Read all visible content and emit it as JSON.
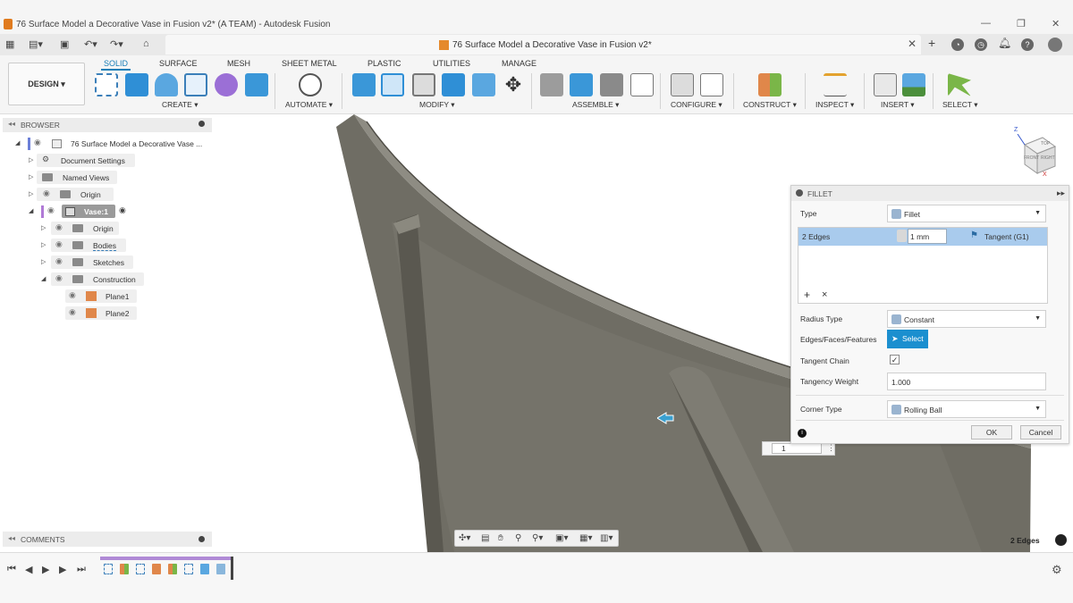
{
  "window": {
    "title": "76 Surface Model a Decorative Vase in Fusion v2* (A TEAM) - Autodesk Fusion",
    "doc_tab_title": "76 Surface Model a Decorative Vase in Fusion v2*"
  },
  "toolbar": {
    "design_label": "DESIGN ▾",
    "workspace_tabs": [
      "SOLID",
      "SURFACE",
      "MESH",
      "SHEET METAL",
      "PLASTIC",
      "UTILITIES",
      "MANAGE"
    ],
    "groups": [
      "CREATE ▾",
      "AUTOMATE ▾",
      "MODIFY ▾",
      "ASSEMBLE ▾",
      "CONFIGURE ▾",
      "CONSTRUCT ▾",
      "INSPECT ▾",
      "INSERT ▾",
      "SELECT ▾"
    ]
  },
  "browser": {
    "header": "BROWSER",
    "items": [
      {
        "label": "76 Surface Model a Decorative Vase ..."
      },
      {
        "label": "Document Settings"
      },
      {
        "label": "Named Views"
      },
      {
        "label": "Origin"
      },
      {
        "label": "Vase:1"
      },
      {
        "label": "Origin"
      },
      {
        "label": "Bodies"
      },
      {
        "label": "Sketches"
      },
      {
        "label": "Construction"
      },
      {
        "label": "Plane1"
      },
      {
        "label": "Plane2"
      }
    ]
  },
  "comments": {
    "header": "COMMENTS"
  },
  "fillet": {
    "header": "FILLET",
    "type_label": "Type",
    "type_value": "Fillet",
    "edges_label": "2 Edges",
    "radius_value": "1 mm",
    "continuity": "Tangent (G1)",
    "add_icon": "+",
    "remove_icon": "×",
    "radius_type_label": "Radius Type",
    "radius_type_value": "Constant",
    "edges_faces_label": "Edges/Faces/Features",
    "select_label": "Select",
    "tangent_chain_label": "Tangent Chain",
    "tangent_chain_checked": true,
    "tangency_weight_label": "Tangency Weight",
    "tangency_weight_value": "1.000",
    "corner_type_label": "Corner Type",
    "corner_type_value": "Rolling Ball",
    "ok_label": "OK",
    "cancel_label": "Cancel"
  },
  "viewport": {
    "selection_status": "2 Edges",
    "radius_input_value": "1",
    "viewcube_labels": [
      "TOP",
      "FRONT",
      "RIGHT"
    ],
    "viewcube_axes": [
      "Z",
      "X"
    ]
  },
  "colors": {
    "accent": "#1b8fcf",
    "selection": "#a9cbed",
    "model": "#6f6d64",
    "timeline_bar": "#b08ad6"
  }
}
